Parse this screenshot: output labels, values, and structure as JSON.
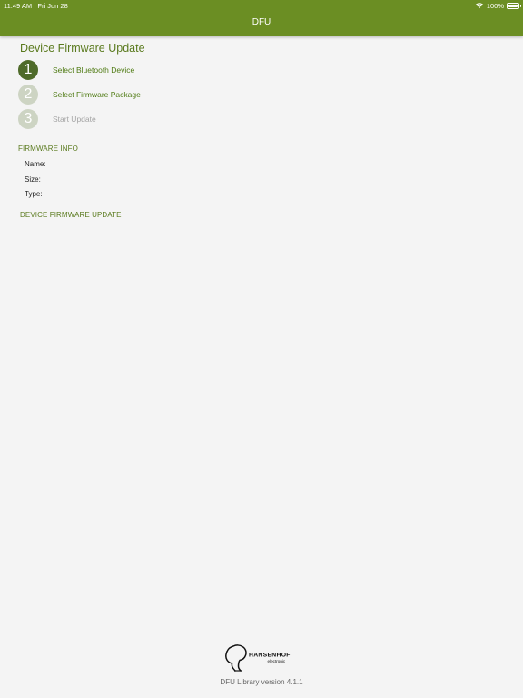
{
  "status_bar": {
    "time": "11:49 AM",
    "date": "Fri Jun 28",
    "battery": "100%"
  },
  "nav": {
    "title": "DFU"
  },
  "page": {
    "title": "Device Firmware Update"
  },
  "steps": [
    {
      "number": "1",
      "label": "Select Bluetooth Device",
      "state": "active"
    },
    {
      "number": "2",
      "label": "Select Firmware Package",
      "state": "pending"
    },
    {
      "number": "3",
      "label": "Start Update",
      "state": "disabled"
    }
  ],
  "firmware_info": {
    "header": "FIRMWARE INFO",
    "name_label": "Name:",
    "size_label": "Size:",
    "type_label": "Type:"
  },
  "dfu_section": {
    "header": "DEVICE FIRMWARE UPDATE"
  },
  "footer": {
    "logo_text": "HANSENHOF",
    "logo_subtext": "_electronic",
    "version": "DFU Library version 4.1.1"
  },
  "colors": {
    "brand_green": "#6b8e23",
    "step_active": "#4f6b2a",
    "step_inactive": "#cdd4c3",
    "label_green": "#4e7a12",
    "background": "#f4f4f4"
  }
}
